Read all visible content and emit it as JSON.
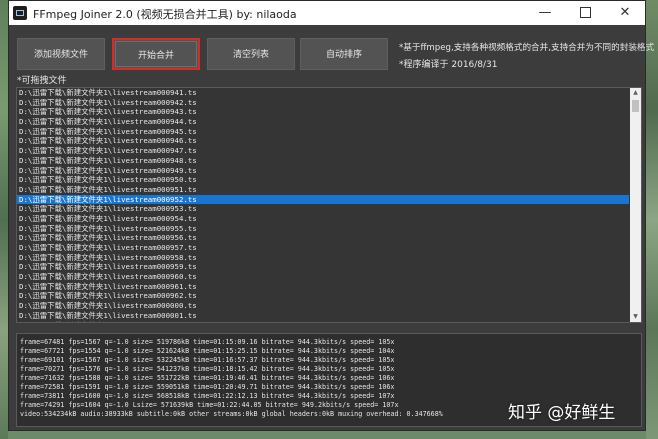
{
  "window": {
    "title": "FFmpeg Joiner 2.0 (视频无损合并工具)  by: nilaoda",
    "icons": {
      "minimize": "minimize-icon",
      "maximize": "maximize-icon",
      "close": "close-icon"
    }
  },
  "toolbar": {
    "add_label": "添加视频文件",
    "merge_label": "开始合并",
    "clear_label": "清空列表",
    "sort_label": "自动排序"
  },
  "info": {
    "line1": "*基于ffmpeg,支持各种视频格式的合并,支持合并为不同的封装格式",
    "line2": "*程序编译于 2016/8/31"
  },
  "drag_hint": "*可拖拽文件",
  "files": {
    "selected_index": 11,
    "items": [
      "D:\\迅雷下载\\新建文件夹1\\livestream000941.ts",
      "D:\\迅雷下载\\新建文件夹1\\livestream000942.ts",
      "D:\\迅雷下载\\新建文件夹1\\livestream000943.ts",
      "D:\\迅雷下载\\新建文件夹1\\livestream000944.ts",
      "D:\\迅雷下载\\新建文件夹1\\livestream000945.ts",
      "D:\\迅雷下载\\新建文件夹1\\livestream000946.ts",
      "D:\\迅雷下载\\新建文件夹1\\livestream000947.ts",
      "D:\\迅雷下载\\新建文件夹1\\livestream000948.ts",
      "D:\\迅雷下载\\新建文件夹1\\livestream000949.ts",
      "D:\\迅雷下载\\新建文件夹1\\livestream000950.ts",
      "D:\\迅雷下载\\新建文件夹1\\livestream000951.ts",
      "D:\\迅雷下载\\新建文件夹1\\livestream000952.ts",
      "D:\\迅雷下载\\新建文件夹1\\livestream000953.ts",
      "D:\\迅雷下载\\新建文件夹1\\livestream000954.ts",
      "D:\\迅雷下载\\新建文件夹1\\livestream000955.ts",
      "D:\\迅雷下载\\新建文件夹1\\livestream000956.ts",
      "D:\\迅雷下载\\新建文件夹1\\livestream000957.ts",
      "D:\\迅雷下载\\新建文件夹1\\livestream000958.ts",
      "D:\\迅雷下载\\新建文件夹1\\livestream000959.ts",
      "D:\\迅雷下载\\新建文件夹1\\livestream000960.ts",
      "D:\\迅雷下载\\新建文件夹1\\livestream000961.ts",
      "D:\\迅雷下载\\新建文件夹1\\livestream000962.ts",
      "D:\\迅雷下载\\新建文件夹1\\livestream000000.ts",
      "D:\\迅雷下载\\新建文件夹1\\livestream000001.ts",
      "D:\\迅雷下载\\新建文件夹1\\livestream000002.ts",
      "D:\\迅雷下载\\新建文件夹1\\livestream000003.ts",
      "D:\\迅雷下载\\新建文件夹1\\livestream000004.ts",
      "D:\\迅雷下载\\新建文件夹1\\livestream000005.ts"
    ]
  },
  "log": {
    "lines": [
      "frame=67481 fps=1567 q=-1.0 size=  519786kB time=01:15:09.16 bitrate= 944.3kbits/s speed= 105x",
      "frame=67721 fps=1554 q=-1.0 size=  521624kB time=01:15:25.15 bitrate= 944.3kbits/s speed= 104x",
      "frame=69101 fps=1567 q=-1.0 size=  532245kB time=01:16:57.37 bitrate= 944.3kbits/s speed= 105x",
      "frame=70271 fps=1576 q=-1.0 size=  541237kB time=01:18:15.42 bitrate= 944.3kbits/s speed= 105x",
      "frame=71632 fps=1588 q=-1.0 size=  551722kB time=01:19:46.41 bitrate= 944.3kbits/s speed= 106x",
      "frame=72581 fps=1591 q=-1.0 size=  559051kB time=01:20:49.71 bitrate= 944.3kbits/s speed= 106x",
      "frame=73811 fps=1600 q=-1.0 size=  568518kB time=01:22:12.13 bitrate= 944.3kbits/s speed= 107x",
      "frame=74291 fps=1604 q=-1.0 Lsize=  571639kB time=01:22:44.05 bitrate= 949.2kbits/s speed= 107x",
      "video:534234kB audio:38933kB subtitle:0kB other streams:0kB global headers:0kB muxing overhead: 0.347668%"
    ]
  },
  "watermark": "知乎 @好鲜生",
  "colors": {
    "window_bg": "#3c3c3c",
    "selection": "#1875d1",
    "highlight_border": "#d92a2a"
  }
}
